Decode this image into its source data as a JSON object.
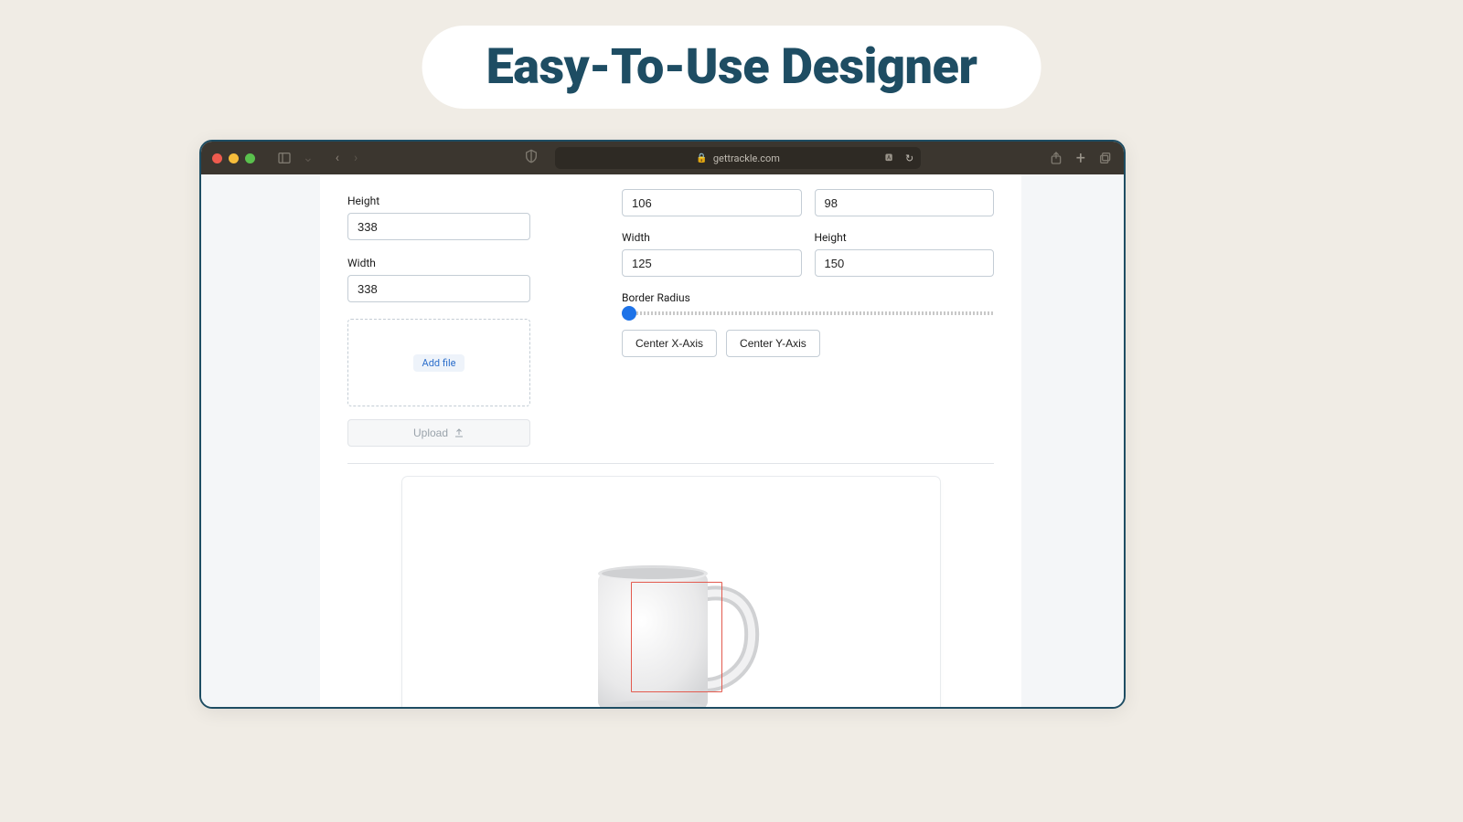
{
  "hero_title": "Easy-To-Use Designer",
  "browser": {
    "url": "gettrackle.com"
  },
  "left": {
    "height_label": "Height",
    "height_value": "338",
    "width_label": "Width",
    "width_value": "338",
    "add_file": "Add file",
    "upload_label": "Upload"
  },
  "right": {
    "top_left_value": "106",
    "top_right_value": "98",
    "width_label": "Width",
    "width_value": "125",
    "height_label": "Height",
    "height_value": "150",
    "border_radius_label": "Border Radius",
    "center_x": "Center X-Axis",
    "center_y": "Center Y-Axis"
  }
}
